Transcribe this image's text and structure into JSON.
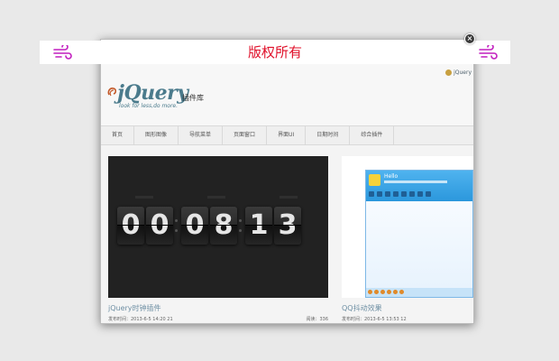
{
  "banner": {
    "text": "版权所有",
    "left_icon": "wind-icon",
    "right_icon": "wind-icon",
    "icon_color": "#c21fbf",
    "text_color": "#e0102a"
  },
  "popup": {
    "close_label": "×"
  },
  "site": {
    "logo_text": "jQuery",
    "logo_cn": "插件库",
    "slogan": "look for less,do more.",
    "brand_small": "jQuery"
  },
  "nav": [
    "首页",
    "图形图像",
    "导航菜单",
    "页面窗口",
    "界面UI",
    "日期时间",
    "综合插件"
  ],
  "cards": [
    {
      "title": "jQuery时钟插件",
      "date": "发布时间：2013-6-5 14:20 21",
      "views": "阅读：336",
      "clock": [
        "0",
        "0",
        "0",
        "8",
        "1",
        "3"
      ]
    },
    {
      "title": "QQ抖动效果",
      "date": "发布时间：2013-6-5 13:53 12",
      "qq_name": "Hello"
    }
  ]
}
